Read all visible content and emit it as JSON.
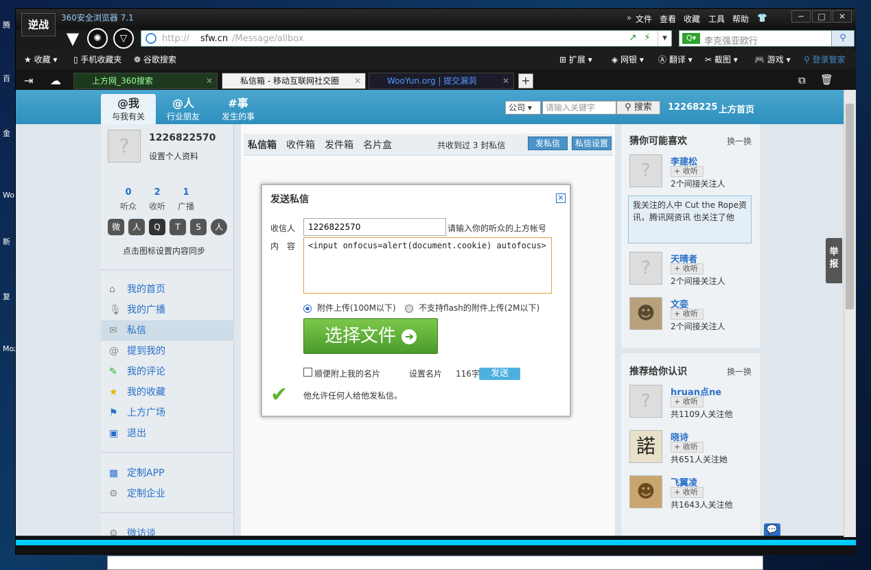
{
  "desktop": {
    "icons": [
      "腾",
      "百",
      "金",
      "Wo",
      "新",
      "复",
      "Moz"
    ]
  },
  "browser": {
    "logo": "逆战",
    "title": "360安全浏览器 7.1",
    "menu": [
      "文件",
      "查看",
      "收藏",
      "工具",
      "帮助"
    ],
    "address": {
      "domain": "sfw.cn",
      "path": "/Message/allbox",
      "ghost": "http://"
    },
    "search_placeholder": "李克强亚欧行",
    "bookmarks": {
      "left": [
        "收藏",
        "手机收藏夹",
        "谷歌搜索"
      ],
      "right": [
        "扩展",
        "网银",
        "翻译",
        "截图",
        "游戏",
        "登录管家"
      ]
    },
    "tabs": [
      {
        "label": "上方网_360搜索"
      },
      {
        "label": "私信箱 - 移动互联网社交圈"
      },
      {
        "label": "WooYun.org | 提交漏洞"
      }
    ]
  },
  "header": {
    "tabs": [
      {
        "title": "@我",
        "sub": "与我有关"
      },
      {
        "title": "@人",
        "sub": "行业朋友"
      },
      {
        "title": "#事",
        "sub": "发生的事"
      }
    ],
    "search_select": "公司",
    "search_placeholder": "请输入关键字",
    "search_btn": "搜索",
    "uid": "12268225",
    "home": "上方首页"
  },
  "profile": {
    "id": "1226822570",
    "edit": "设置个人资料",
    "stats": [
      {
        "n": "0",
        "l": "听众"
      },
      {
        "n": "2",
        "l": "收听"
      },
      {
        "n": "1",
        "l": "广播"
      }
    ],
    "sync_hint": "点击图标设置内容同步"
  },
  "leftnav": [
    {
      "label": "我的首页",
      "icon": "home-icon"
    },
    {
      "label": "我的广播",
      "icon": "mic-icon"
    },
    {
      "label": "私信",
      "icon": "mail-icon"
    },
    {
      "label": "提到我的",
      "icon": "at-icon"
    },
    {
      "label": "我的评论",
      "icon": "edit-icon"
    },
    {
      "label": "我的收藏",
      "icon": "star-icon"
    },
    {
      "label": "上方广场",
      "icon": "plaza-icon"
    },
    {
      "label": "退出",
      "icon": "exit-icon"
    }
  ],
  "leftnav2": [
    {
      "label": "定制APP"
    },
    {
      "label": "定制企业"
    },
    {
      "label": "微访谈"
    }
  ],
  "center": {
    "tabs": [
      "私信箱",
      "收件箱",
      "发件箱",
      "名片盒"
    ],
    "count_text": "共收到过 3 封私信",
    "btn_send": "发私信",
    "btn_settings": "私信设置"
  },
  "modal": {
    "title": "发送私信",
    "to_label": "收信人",
    "to_value": "1226822570",
    "to_hint": "请输入你的听众的上方帐号",
    "content_label": "内　容",
    "content_value": "<input onfocus=alert(document.cookie) autofocus>",
    "radio1": "附件上传(100M以下)",
    "radio2": "不支持flash的附件上传(2M以下)",
    "choose_file": "选择文件",
    "attach_card": "顺便附上我的名片",
    "set_card": "设置名片",
    "chars": "116字",
    "send": "发送",
    "allow_text": "他允许任何人给他发私信。"
  },
  "right": {
    "sec1": "猜你可能喜欢",
    "change": "换一换",
    "people1": [
      {
        "name": "李建松",
        "desc": "2个间接关注人"
      },
      {
        "name": "天晴者",
        "desc": "2个间接关注人"
      },
      {
        "name": "文娈",
        "desc": "2个间接关注人"
      }
    ],
    "follow": "收听",
    "tip": "我关注的人中 Cut the Rope资讯，腾讯网资讯 也关注了他",
    "sec2": "推荐给你认识",
    "people2": [
      {
        "name": "hruan点ne",
        "desc": "共1109人关注他"
      },
      {
        "name": "晓诗",
        "desc": "共651人关注她"
      },
      {
        "name": "飞翼凌",
        "desc": "共1643人关注他"
      }
    ]
  },
  "report": "举报"
}
